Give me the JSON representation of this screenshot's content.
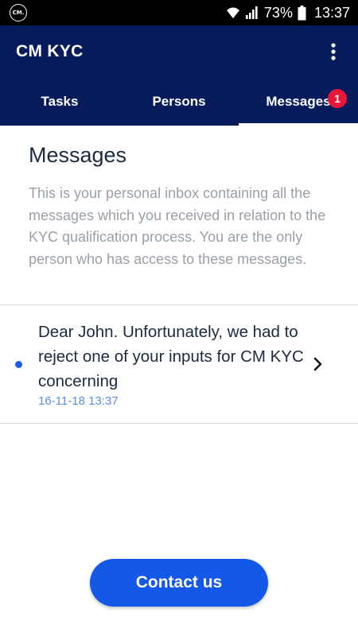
{
  "status_bar": {
    "app_icon": "cm-logo-icon",
    "app_icon_text": "CM.",
    "battery_percent": "73%",
    "time": "13:37"
  },
  "app_bar": {
    "title": "CM KYC",
    "menu_icon": "more-vert-icon"
  },
  "tabs": [
    {
      "label": "Tasks",
      "active": false
    },
    {
      "label": "Persons",
      "active": false
    },
    {
      "label": "Messages",
      "active": true,
      "badge": "1"
    }
  ],
  "main": {
    "heading": "Messages",
    "intro": "This is your personal inbox containing all the messages which you received in relation to the KYC qualification process. You are the only person who has access to these messages.",
    "messages": [
      {
        "preview": "Dear John. Unfortunately, we had to reject one of your inputs for CM KYC concerning",
        "date": "16-11-18 13:37",
        "unread": true
      }
    ]
  },
  "contact_button": {
    "label": "Contact us"
  },
  "colors": {
    "primary_dark": "#081c5c",
    "accent_blue": "#1458e8",
    "badge_red": "#e8173a",
    "date_blue": "#5b8ce6",
    "muted_text": "#9aa0a8"
  }
}
